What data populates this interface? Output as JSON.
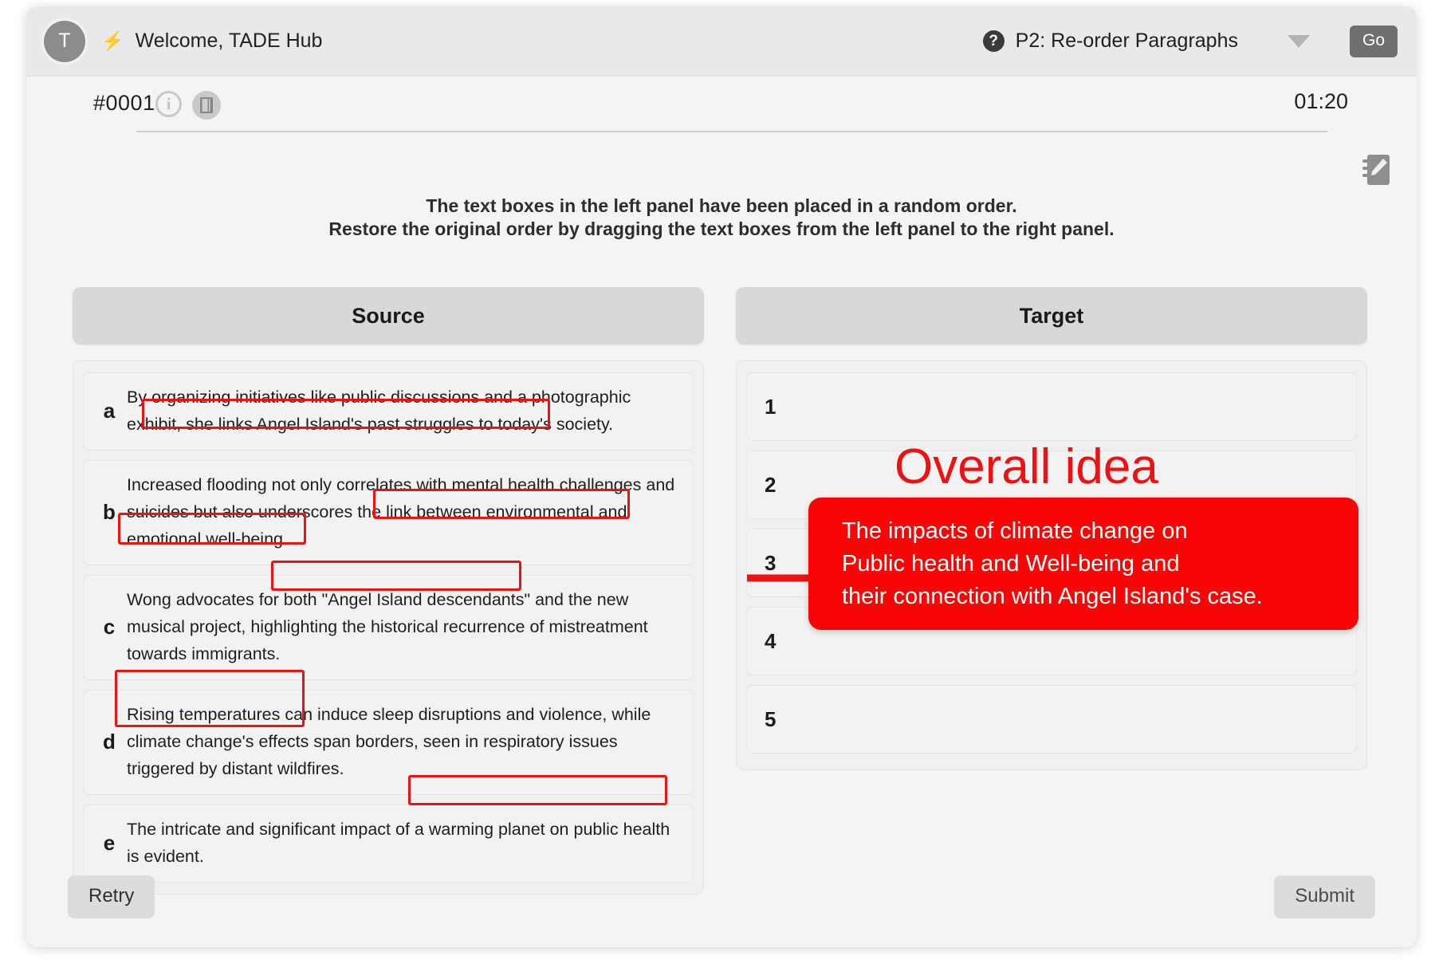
{
  "header": {
    "avatar_initial": "T",
    "bolt_icon": "bolt-icon",
    "welcome": "Welcome, TADE Hub",
    "help_icon": "question-mark-icon",
    "mode_label": "P2: Re-order Paragraphs",
    "dropdown_icon": "chevron-down-icon",
    "go_label": "Go"
  },
  "meta": {
    "item_id": "#0001",
    "info_icon": "info-icon",
    "book_icon": "book-icon",
    "timer": "01:20",
    "notepad_icon": "notepad-pencil-icon"
  },
  "instructions": {
    "line1": "The text boxes in the left panel have been placed in a random order.",
    "line2": "Restore the original order by dragging the text boxes from the left panel to the right panel."
  },
  "source": {
    "title": "Source",
    "items": [
      {
        "letter": "a",
        "text": "By organizing initiatives like public discussions and a photographic exhibit, she links Angel Island's past struggles to today's society."
      },
      {
        "letter": "b",
        "text": "Increased flooding not only correlates with mental health challenges and suicides but also underscores the link between environmental and emotional well-being."
      },
      {
        "letter": "c",
        "text": "Wong advocates for both \"Angel Island descendants\" and the new musical project, highlighting the historical recurrence of mistreatment towards immigrants."
      },
      {
        "letter": "d",
        "text": "Rising temperatures can induce sleep disruptions and violence, while climate change's effects span borders, seen in respiratory issues triggered by distant wildfires."
      },
      {
        "letter": "e",
        "text": "The intricate and significant impact of a warming planet on public health is evident."
      }
    ]
  },
  "target": {
    "title": "Target",
    "slots": [
      "1",
      "2",
      "3",
      "4",
      "5"
    ]
  },
  "footer": {
    "retry_label": "Retry",
    "submit_label": "Submit"
  },
  "annotation": {
    "heading": "Overall idea",
    "body_line1": "The impacts of climate change on",
    "body_line2": "Public health and Well-being and",
    "body_line3": "their connection with Angel Island's case.",
    "accent_color": "#fa0505",
    "highlight_color": "#ee1111",
    "arrow_icon": "right-arrow-icon",
    "highlighted_phrases": [
      "she links Angel Island's past struggles to today's society.",
      "link between environmental and",
      "emotional well-being.",
      "both \"Angel Island descendants\"",
      "Rising temperatures can / climate change's effects",
      "a warming planet on public health"
    ]
  }
}
